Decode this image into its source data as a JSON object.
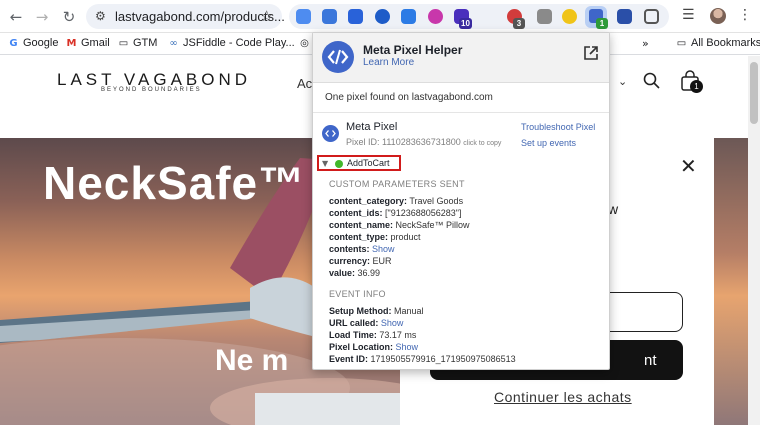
{
  "browser": {
    "url": "lastvagabond.com/products...",
    "extension_badges": [
      "10",
      "3",
      "1"
    ],
    "bookmarks": [
      "Google",
      "Gmail",
      "GTM",
      "JSFiddle - Code Play...",
      "Co",
      "All Bookmarks"
    ]
  },
  "site": {
    "logo": "LAST VAGABOND",
    "tagline": "BEYOND BOUNDARIES",
    "nav_peek": "Ac",
    "cart_count": "1",
    "hero_title": "NeckSafe™",
    "hero_subtitle": "Ne m",
    "drawer_peek": "w",
    "checkout_peek": "nt",
    "continue_label": "Continuer les achats"
  },
  "popup": {
    "title": "Meta Pixel Helper",
    "learn_more": "Learn More",
    "found": "One pixel found on lastvagabond.com",
    "pixel_name": "Meta Pixel",
    "pixel_id": "Pixel ID: 1110283636731800",
    "click_to_copy": "click to copy",
    "troubleshoot": "Troubleshoot Pixel",
    "setup_events": "Set up events",
    "event_name": "AddToCart",
    "custom_params_heading": "CUSTOM PARAMETERS SENT",
    "params": [
      {
        "key": "content_category:",
        "value": "Travel Goods"
      },
      {
        "key": "content_ids:",
        "value": "[\"9123688056283\"]"
      },
      {
        "key": "content_name:",
        "value": "NeckSafe™ Pillow"
      },
      {
        "key": "content_type:",
        "value": "product"
      },
      {
        "key": "contents:",
        "value": "Show"
      },
      {
        "key": "currency:",
        "value": "EUR"
      },
      {
        "key": "value:",
        "value": "36.99"
      }
    ],
    "event_info_heading": "EVENT INFO",
    "info": [
      {
        "key": "Setup Method:",
        "value": "Manual"
      },
      {
        "key": "URL called:",
        "value": "Show"
      },
      {
        "key": "Load Time:",
        "value": "73.17 ms"
      },
      {
        "key": "Pixel Location:",
        "value": "Show"
      },
      {
        "key": "Event ID:",
        "value": "1719505579916_171950975086513"
      }
    ]
  },
  "colors": {
    "meta_blue": "#3f66c9",
    "link_blue": "#4267b2",
    "highlight_red": "#d11b1b",
    "success_green": "#42b72a"
  }
}
